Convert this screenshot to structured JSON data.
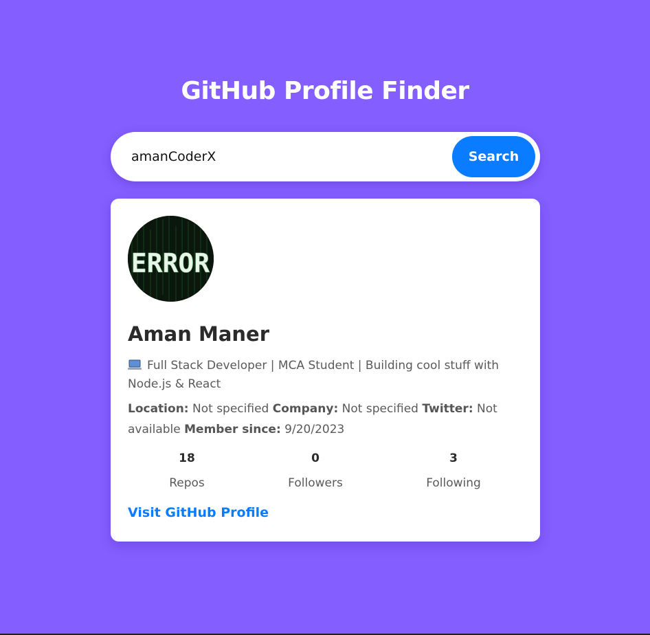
{
  "app": {
    "title": "GitHub Profile Finder"
  },
  "search": {
    "value": "amanCoderX",
    "button_label": "Search"
  },
  "profile": {
    "avatar_text": "ERROR",
    "name": "Aman Maner",
    "bio": "Full Stack Developer | MCA Student | Building cool stuff with Node.js & React",
    "location_label": "Location:",
    "location_value": "Not specified",
    "company_label": "Company:",
    "company_value": "Not specified",
    "twitter_label": "Twitter:",
    "twitter_value": "Not available",
    "member_since_label": "Member since:",
    "member_since_value": "9/20/2023",
    "stats": [
      {
        "value": "18",
        "label": "Repos"
      },
      {
        "value": "0",
        "label": "Followers"
      },
      {
        "value": "3",
        "label": "Following"
      }
    ],
    "visit_link_label": "Visit GitHub Profile"
  },
  "colors": {
    "background": "#845eff",
    "accent": "#0a7cff",
    "card": "#ffffff"
  }
}
